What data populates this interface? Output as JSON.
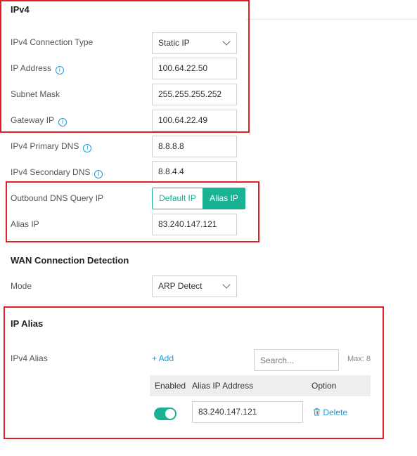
{
  "ipv4": {
    "title": "IPv4",
    "connection_type": {
      "label": "IPv4 Connection Type",
      "value": "Static IP"
    },
    "ip_address": {
      "label": "IP Address",
      "value": "100.64.22.50"
    },
    "subnet_mask": {
      "label": "Subnet Mask",
      "value": "255.255.255.252"
    },
    "gateway_ip": {
      "label": "Gateway IP",
      "value": "100.64.22.49"
    },
    "primary_dns": {
      "label": "IPv4 Primary DNS",
      "value": "8.8.8.8"
    },
    "secondary_dns": {
      "label": "IPv4 Secondary DNS",
      "value": "8.8.4.4"
    },
    "outbound_dns": {
      "label": "Outbound DNS Query IP",
      "options": [
        "Default IP",
        "Alias IP"
      ],
      "selected": "Alias IP"
    },
    "alias_ip": {
      "label": "Alias IP",
      "value": "83.240.147.121"
    }
  },
  "wan_detection": {
    "title": "WAN Connection Detection",
    "mode": {
      "label": "Mode",
      "value": "ARP Detect"
    }
  },
  "ip_alias": {
    "title": "IP Alias",
    "ipv4_alias_label": "IPv4 Alias",
    "add_label": "+ Add",
    "search_placeholder": "Search...",
    "max_label": "Max: 8",
    "columns": [
      "Enabled",
      "Alias IP Address",
      "Option"
    ],
    "rows": [
      {
        "enabled": true,
        "address": "83.240.147.121",
        "option": "Delete"
      }
    ]
  },
  "colors": {
    "accent": "#19b394",
    "link": "#1a9bd7",
    "highlight": "#e21e2a"
  },
  "icons": {
    "info": "info-icon",
    "chevron": "chevron-down-icon",
    "delete": "trash-icon",
    "toggle": "toggle-switch"
  }
}
